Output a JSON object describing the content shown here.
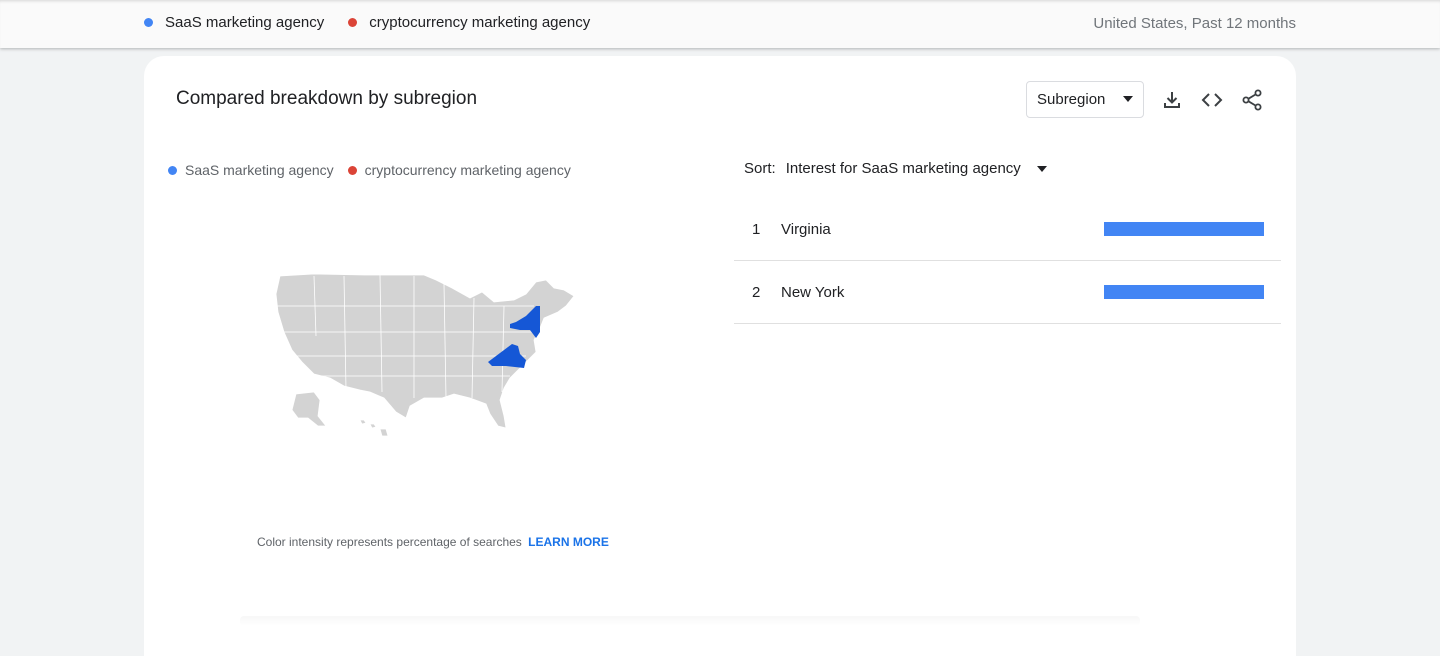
{
  "header": {
    "terms": [
      {
        "label": "SaaS marketing agency",
        "color": "#4285f4"
      },
      {
        "label": "cryptocurrency marketing agency",
        "color": "#db4437"
      }
    ],
    "meta": "United States, Past 12 months"
  },
  "card": {
    "title": "Compared breakdown by subregion",
    "resolution_select": "Subregion",
    "icons": [
      "download-icon",
      "embed-code-icon",
      "share-icon"
    ],
    "legend": [
      {
        "label": "SaaS marketing agency",
        "color": "#4285f4"
      },
      {
        "label": "cryptocurrency marketing agency",
        "color": "#db4437"
      }
    ],
    "map": {
      "highlighted_states": [
        "Virginia",
        "New York"
      ],
      "highlight_color": "#1557d6",
      "base_color": "#d3d3d3"
    },
    "footnote": "Color intensity represents percentage of searches",
    "learn_more": "LEARN MORE",
    "sort": {
      "label": "Sort:",
      "value": "Interest for SaaS marketing agency"
    },
    "rows": [
      {
        "rank": "1",
        "name": "Virginia",
        "value": 100
      },
      {
        "rank": "2",
        "name": "New York",
        "value": 100
      }
    ]
  }
}
